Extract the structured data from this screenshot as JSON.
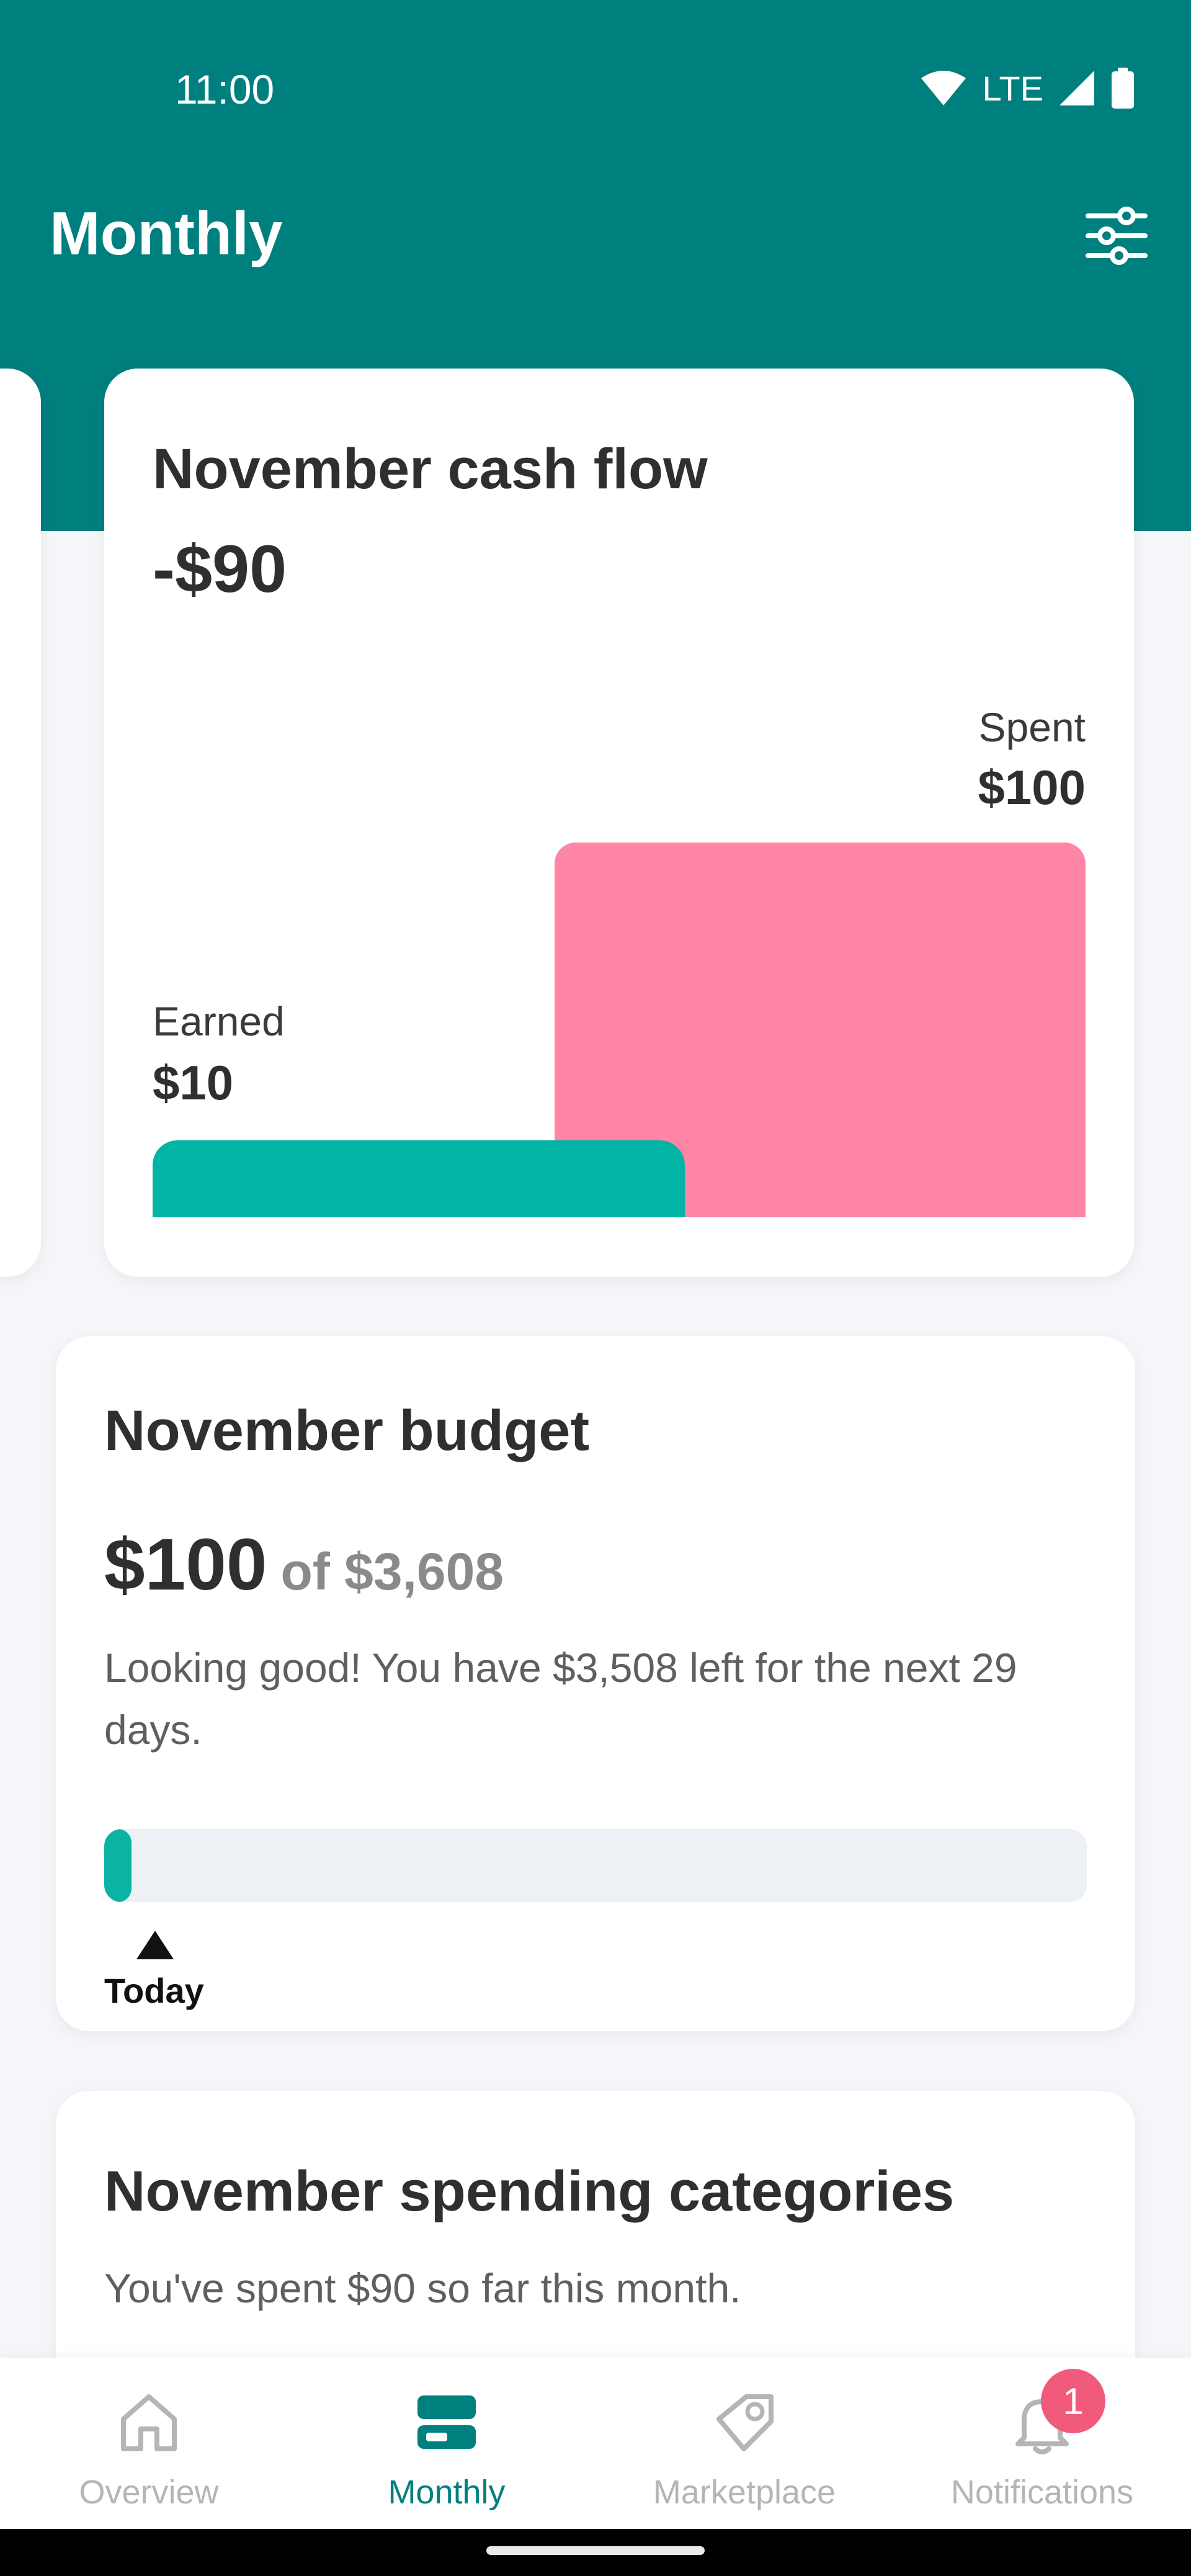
{
  "status_bar": {
    "time": "11:00",
    "network": "LTE"
  },
  "header": {
    "title": "Monthly"
  },
  "cash_flow": {
    "title": "November cash flow",
    "net": "-$90",
    "spent_label": "Spent",
    "spent_value": "$100",
    "earned_label": "Earned",
    "earned_value": "$10",
    "colors": {
      "spent": "#ff85a7",
      "earned": "#02b4a5"
    }
  },
  "budget": {
    "title": "November budget",
    "amount": "$100",
    "of_total": "of $3,608",
    "message": "Looking good! You have $3,508 left for the next 29 days.",
    "progress_fraction": 0.028,
    "today_label": "Today"
  },
  "spending": {
    "title": "November spending categories",
    "subtitle": "You've spent $90 so far this month."
  },
  "nav": {
    "items": [
      {
        "label": "Overview",
        "icon": "home-icon"
      },
      {
        "label": "Monthly",
        "icon": "monthly-icon",
        "active": true
      },
      {
        "label": "Marketplace",
        "icon": "marketplace-tag-icon"
      },
      {
        "label": "Notifications",
        "icon": "bell-icon"
      }
    ],
    "notification_count": "1"
  },
  "colors": {
    "header": "#007f7f",
    "accent": "#007f7f",
    "badge": "#f25a7c"
  }
}
